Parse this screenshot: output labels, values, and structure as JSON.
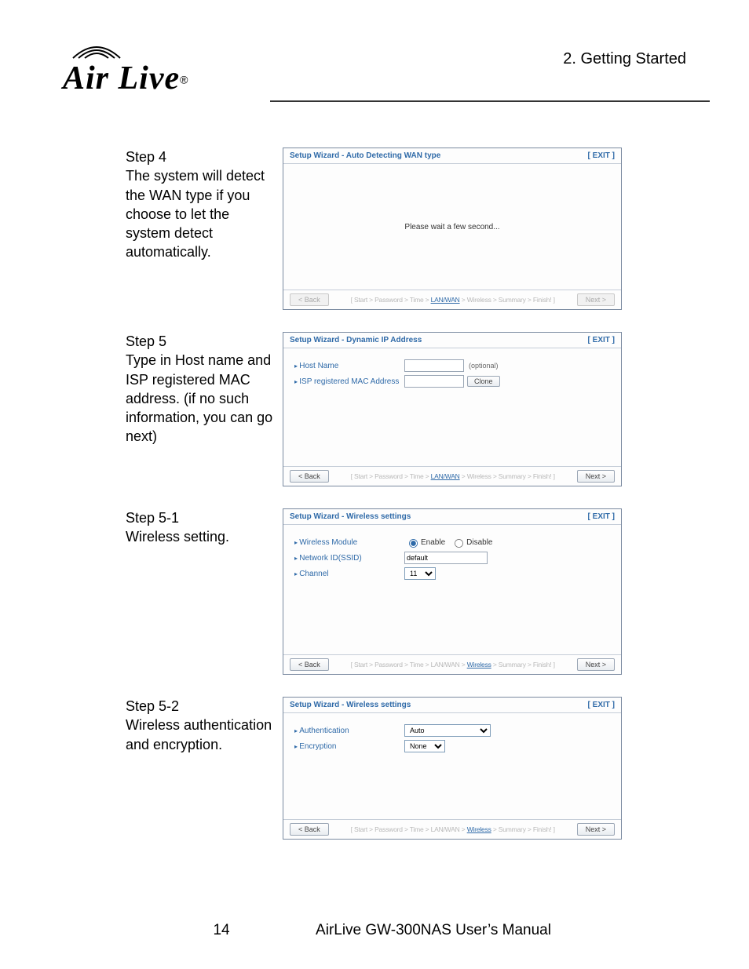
{
  "header": {
    "chapter": "2.  Getting  Started",
    "logo_text": "Air Live",
    "logo_reg": "®"
  },
  "steps": {
    "s4": {
      "title": "Step 4",
      "body": "The system will detect the WAN type if you choose to let the system detect automatically.",
      "panel_title": "Setup Wizard - Auto Detecting WAN type",
      "exit": "[ EXIT ]",
      "wait": "Please wait a few second...",
      "back": "< Back",
      "next": "Next >",
      "crumbs_pre": "[ Start > Password > Time > ",
      "crumbs_active": "LAN/WAN",
      "crumbs_post": " > Wireless > Summary > Finish! ]"
    },
    "s5": {
      "title": "Step 5",
      "body": "Type in Host name and ISP registered MAC address. (if no such information, you can go next)",
      "panel_title": "Setup Wizard - Dynamic IP Address",
      "exit": "[ EXIT ]",
      "host_label": "Host Name",
      "optional": "(optional)",
      "mac_label": "ISP registered MAC Address",
      "clone": "Clone",
      "back": "< Back",
      "next": "Next >",
      "crumbs_pre": "[ Start > Password > Time > ",
      "crumbs_active": "LAN/WAN",
      "crumbs_post": " > Wireless > Summary > Finish! ]"
    },
    "s51": {
      "title": "Step 5-1",
      "body": "Wireless setting.",
      "panel_title": "Setup Wizard - Wireless settings",
      "exit": "[ EXIT ]",
      "module_label": "Wireless Module",
      "enable": "Enable",
      "disable": "Disable",
      "ssid_label": "Network ID(SSID)",
      "ssid_value": "default",
      "channel_label": "Channel",
      "channel_value": "11",
      "back": "< Back",
      "next": "Next >",
      "crumbs_pre": "[ Start > Password > Time > LAN/WAN > ",
      "crumbs_active": "Wireless",
      "crumbs_post": " > Summary > Finish! ]"
    },
    "s52": {
      "title": "Step 5-2",
      "body": "Wireless authentication and encryption.",
      "panel_title": "Setup Wizard - Wireless settings",
      "exit": "[ EXIT ]",
      "auth_label": "Authentication",
      "auth_value": "Auto",
      "enc_label": "Encryption",
      "enc_value": "None",
      "back": "< Back",
      "next": "Next >",
      "crumbs_pre": "[ Start > Password > Time > LAN/WAN > ",
      "crumbs_active": "Wireless",
      "crumbs_post": " > Summary > Finish! ]"
    }
  },
  "footer": {
    "page": "14",
    "manual": "AirLive GW-300NAS User’s Manual"
  }
}
